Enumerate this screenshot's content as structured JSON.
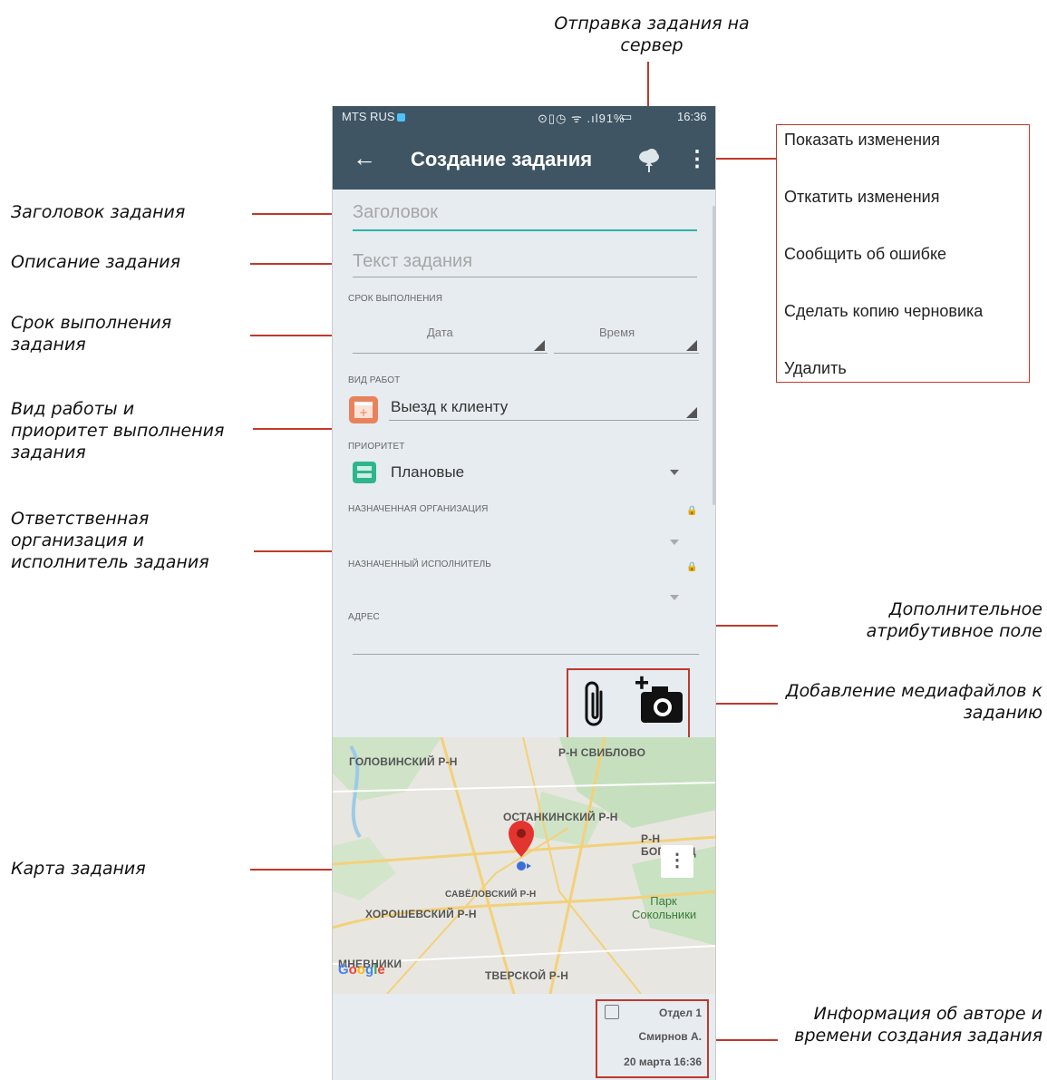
{
  "callouts": {
    "send_to_server": "Отправка задания на сервер",
    "task_title": "Заголовок задания",
    "task_description": "Описание задания",
    "due_date": "Срок выполнения задания",
    "work_type_priority": "Вид работы и приоритет выполнения задания",
    "org_executor": "Ответственная организация и исполнитель задания",
    "extra_attribute": "Дополнительное атрибутивное поле",
    "media": "Добавление медиафайлов к заданию",
    "task_map": "Карта задания",
    "author_info": "Информация об авторе и времени создания задания"
  },
  "statusbar": {
    "carrier": "MTS RUS",
    "icons": "⊙▯◷ ᯤ .ıl91%",
    "battery": "▭",
    "time": "16:36"
  },
  "appbar": {
    "back": "←",
    "title": "Создание задания",
    "more": "⋮"
  },
  "form": {
    "title_placeholder": "Заголовок",
    "text_placeholder": "Текст задания",
    "due_label": "СРОК ВЫПОЛНЕНИЯ",
    "date": "Дата",
    "time": "Время",
    "work_type_label": "ВИД РАБОТ",
    "work_type_value": "Выезд к клиенту",
    "priority_label": "ПРИОРИТЕТ",
    "priority_value": "Плановые",
    "org_label": "НАЗНАЧЕННАЯ ОРГАНИЗАЦИЯ",
    "executor_label": "НАЗНАЧЕННЫЙ ИСПОЛНИТЕЛЬ",
    "address_label": "АДРЕС"
  },
  "map": {
    "labels": [
      "ГОЛОВИНСКИЙ Р-Н",
      "Р-Н СВИБЛОВО",
      "ОСТАНКИНСКИЙ Р-Н",
      "Р-Н БОГОРОД",
      "САВЁЛОВСКИЙ Р-Н",
      "ХОРОШЕВСКИЙ Р-Н",
      "МНЕВНИКИ",
      "ТВЕРСКОЙ Р-Н"
    ],
    "park": "Парк Сокольники",
    "google": "Google"
  },
  "author": {
    "dept": "Отдел 1",
    "name": "Смирнов А.",
    "date": "20 марта 16:36"
  },
  "menu": {
    "items": [
      "Показать изменения",
      "Откатить изменения",
      "Сообщить об ошибке",
      "Сделать копию черновика",
      "Удалить"
    ]
  },
  "colors": {
    "appbar": "#3f5563",
    "accent": "#c0392b",
    "field_underline_focus": "#2bb3a8",
    "work_type_icon": "#e8825c",
    "priority_icon": "#2fb58d"
  }
}
